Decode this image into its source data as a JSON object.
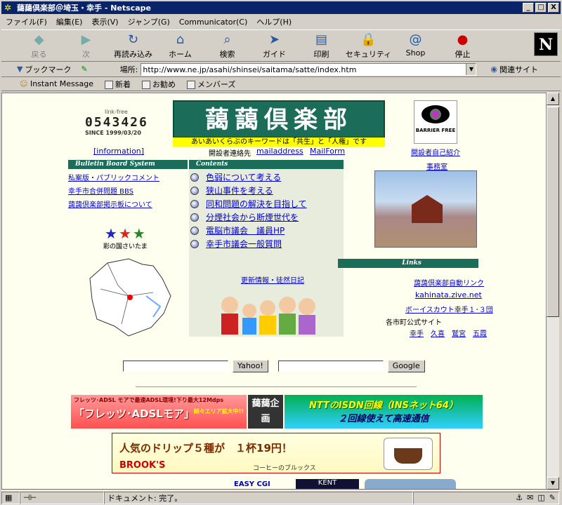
{
  "window": {
    "title": "藹藹倶楽部＠埼玉・幸手 - Netscape",
    "min": "_",
    "max": "□",
    "close": "X"
  },
  "menu": [
    "ファイル(F)",
    "編集(E)",
    "表示(V)",
    "ジャンプ(G)",
    "Communicator(C)",
    "ヘルプ(H)"
  ],
  "toolbar": [
    {
      "label": "戻る",
      "icon": "back-icon",
      "glyph": "◆",
      "disabled": true
    },
    {
      "label": "次",
      "icon": "forward-icon",
      "glyph": "▶",
      "disabled": true
    },
    {
      "label": "再読み込み",
      "icon": "reload-icon",
      "glyph": "↻",
      "disabled": false
    },
    {
      "label": "ホーム",
      "icon": "home-icon",
      "glyph": "⌂",
      "disabled": false
    },
    {
      "label": "検索",
      "icon": "search-icon",
      "glyph": "⌕",
      "disabled": false
    },
    {
      "label": "ガイド",
      "icon": "guide-icon",
      "glyph": "➤",
      "disabled": false
    },
    {
      "label": "印刷",
      "icon": "print-icon",
      "glyph": "▤",
      "disabled": false
    },
    {
      "label": "セキュリティ",
      "icon": "lock-icon",
      "glyph": "🔒",
      "disabled": false
    },
    {
      "label": "Shop",
      "icon": "shop-icon",
      "glyph": "@",
      "disabled": false
    },
    {
      "label": "停止",
      "icon": "stop-icon",
      "glyph": "●",
      "disabled": false
    }
  ],
  "logo": "N",
  "location": {
    "bookmarks": "ブックマーク",
    "label": "場所:",
    "url": "http://www.ne.jp/asahi/shinsei/saitama/satte/index.htm",
    "related": "関連サイト"
  },
  "personal": [
    "Instant Message",
    "新着",
    "お勧め",
    "メンバーズ"
  ],
  "page": {
    "counter_label": "link-free",
    "counter": "0543426",
    "since": "SINCE 1999/03/20",
    "club_title": "藹藹倶楽部",
    "slogan": "あいあいくらぶのキーワードは「共生」と「人権」です",
    "barrier": "BARRIER FREE",
    "information": "[information]",
    "contact_label": "開設者連絡先",
    "mailaddress": "mailaddress",
    "mailform": "MailForm",
    "self_intro": "開設者自己紹介",
    "bbs_header": "Bulletin Board System",
    "bbs": [
      "私案版・パブリックコメント",
      "幸手市合併問題 BBS",
      "藹藹倶楽部掲示板について"
    ],
    "contents_header": "Contents",
    "contents": [
      "色弱について考える",
      "狭山事件を考える",
      "同和問題の解決を目指して",
      "分煙社会から断煙世代を",
      "電脳市議会　議員HP",
      "幸手市議会一般質問"
    ],
    "office": "事務室",
    "saitama": "彩の国さいたま",
    "links_header": "Links",
    "diary": "更新情報・徒然日記",
    "links": [
      "藹藹倶楽部自動リンク",
      "kahinata.zive.net",
      "ボーイスカウト幸手１･３団"
    ],
    "official": "各市町公式サイト",
    "towns": [
      "幸手",
      "久喜",
      "鷲宮",
      "五霞"
    ],
    "yahoo": "Yahoo!",
    "google": "Google",
    "ad1_line1": "フレッツ･ADSL モアで最速ADSL環境!下り最大12Mdps",
    "ad1_line2": "「フレッツ･ADSLモア」",
    "ad1_note": "続々エリア拡大中!!",
    "ad_brand": "藹藹企画",
    "ad3_line1": "NTTのISDN回線（INSネット64）",
    "ad3_line2": "２回線使えて高速通信",
    "ad4_line1": "人気のドリップ５種が　１杯19円！",
    "ad4_brand": "BROOK'S",
    "ad4_sub": "コーヒーのブルックス",
    "ad5": "EASY CGI",
    "ad6": "KENT"
  },
  "status": {
    "text": "ドキュメント: 完了。"
  }
}
